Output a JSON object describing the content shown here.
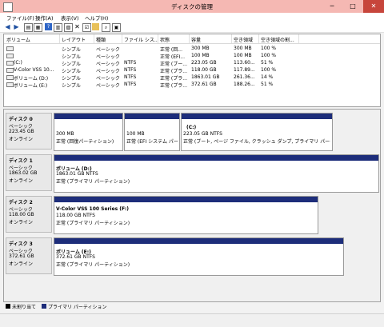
{
  "window": {
    "title": "ディスクの管理",
    "min": "─",
    "max": "□",
    "close": "✕"
  },
  "menu": [
    "ファイル(F)",
    "操作(A)",
    "表示(V)",
    "ヘルプ(H)"
  ],
  "columns": [
    "ボリューム",
    "レイアウト",
    "種類",
    "ファイル シス...",
    "状態",
    "容量",
    "空き領域",
    "空き領域の割..."
  ],
  "volumes": [
    [
      "",
      "シンプル",
      "ベーシック",
      "",
      "正常 (回...",
      "300 MB",
      "300 MB",
      "100 %"
    ],
    [
      "",
      "シンプル",
      "ベーシック",
      "",
      "正常 (EFI...",
      "100 MB",
      "100 MB",
      "100 %"
    ],
    [
      "(C:)",
      "シンプル",
      "ベーシック",
      "NTFS",
      "正常 (ブー...",
      "223.05 GB",
      "113.60...",
      "51 %"
    ],
    [
      "V-Color VSS 10...",
      "シンプル",
      "ベーシック",
      "NTFS",
      "正常 (プラ...",
      "118.00 GB",
      "117.89...",
      "100 %"
    ],
    [
      "ボリューム (D:)",
      "シンプル",
      "ベーシック",
      "NTFS",
      "正常 (プラ...",
      "1863.01 GB",
      "261.36...",
      "14 %"
    ],
    [
      "ボリューム (E:)",
      "シンプル",
      "ベーシック",
      "NTFS",
      "正常 (プラ...",
      "372.61 GB",
      "188.26...",
      "51 %"
    ]
  ],
  "disks": [
    {
      "name": "ディスク 0",
      "type": "ベーシック",
      "size": "223.45 GB",
      "status": "オンライン",
      "partitions": [
        {
          "name": "",
          "size": "300 MB",
          "status": "正常 (回復パーティション)"
        },
        {
          "name": "",
          "size": "100 MB",
          "status": "正常 (EFI システム パー"
        },
        {
          "name": "(C:)",
          "size": "223.05 GB NTFS",
          "status": "正常 (ブート, ページ ファイル, クラッシュ ダンプ, プライマリ パーティション)"
        }
      ]
    },
    {
      "name": "ディスク 1",
      "type": "ベーシック",
      "size": "1863.02 GB",
      "status": "オンライン",
      "partitions": [
        {
          "name": "ボリューム (D:)",
          "size": "1863.01 GB NTFS",
          "status": "正常 (プライマリ パーティション)"
        }
      ]
    },
    {
      "name": "ディスク 2",
      "type": "ベーシック",
      "size": "118.00 GB",
      "status": "オンライン",
      "partitions": [
        {
          "name": "V-Color VSS 100 Series (F:)",
          "size": "118.00 GB NTFS",
          "status": "正常 (プライマリ パーティション)"
        }
      ]
    },
    {
      "name": "ディスク 3",
      "type": "ベーシック",
      "size": "372.61 GB",
      "status": "オンライン",
      "partitions": [
        {
          "name": "ボリューム (E:)",
          "size": "372.61 GB NTFS",
          "status": "正常 (プライマリ パーティション)"
        }
      ]
    }
  ],
  "legend": [
    "未割り当て",
    "プライマリ パーティション"
  ],
  "colors": {
    "titlebar": "#f5b8b3",
    "primary": "#1d2d7a",
    "unallocated": "#000000"
  }
}
